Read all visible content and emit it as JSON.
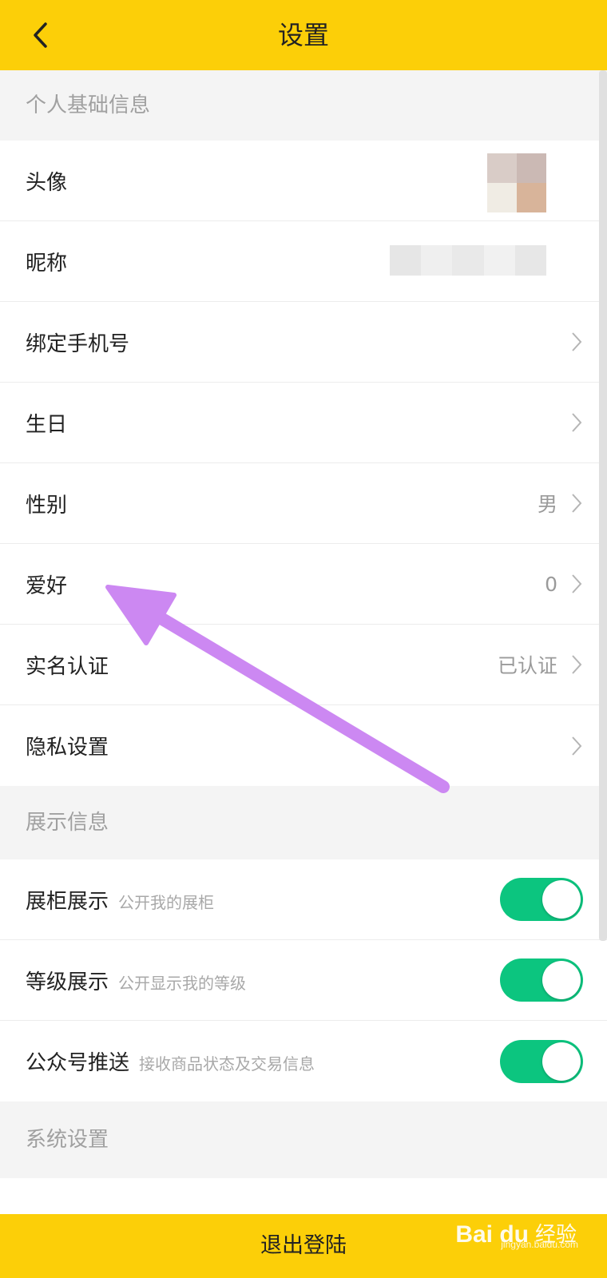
{
  "header": {
    "title": "设置",
    "back_icon": "chevron-left-icon"
  },
  "sections": {
    "basic": {
      "title": "个人基础信息",
      "avatar_label": "头像",
      "nickname_label": "昵称",
      "phone_label": "绑定手机号",
      "birthday_label": "生日",
      "gender_label": "性别",
      "gender_value": "男",
      "hobby_label": "爱好",
      "hobby_value": "0",
      "realname_label": "实名认证",
      "realname_value": "已认证",
      "privacy_label": "隐私设置"
    },
    "display": {
      "title": "展示信息",
      "cabinet_label": "展柜展示",
      "cabinet_desc": "公开我的展柜",
      "cabinet_on": true,
      "level_label": "等级展示",
      "level_desc": "公开显示我的等级",
      "level_on": true,
      "wechat_label": "公众号推送",
      "wechat_desc": "接收商品状态及交易信息",
      "wechat_on": true
    },
    "system": {
      "title": "系统设置"
    }
  },
  "footer": {
    "logout_label": "退出登陆"
  },
  "watermark": {
    "logo": "Bai du",
    "text": "经验",
    "url": "jingyan.baidu.com"
  },
  "colors": {
    "accent": "#fccf08",
    "toggle_on": "#0cc57f",
    "annotation_arrow": "#cc88f2"
  }
}
